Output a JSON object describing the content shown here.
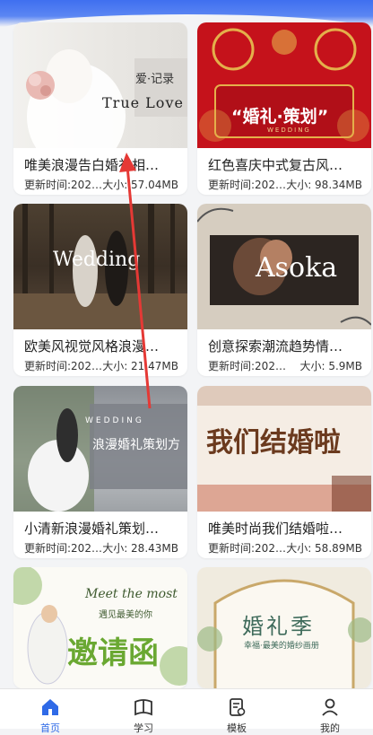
{
  "templates": [
    {
      "title": "唯美浪漫告白婚礼相…",
      "time": "更新时间:202…",
      "size": "大小: 57.04MB",
      "overlay": [
        "爱·记录",
        "True Love"
      ]
    },
    {
      "title": "红色喜庆中式复古风…",
      "time": "更新时间:202…",
      "size": "大小: 98.34MB",
      "overlay": [
        "“婚礼·策划”",
        "WEDDING"
      ]
    },
    {
      "title": "欧美风视觉风格浪漫…",
      "time": "更新时间:202…",
      "size": "大小: 21.47MB",
      "overlay": [
        "Wedding"
      ]
    },
    {
      "title": "创意探索潮流趋势情…",
      "time": "更新时间:202…",
      "size": "大小: 5.9MB",
      "overlay": [
        "Asoka"
      ]
    },
    {
      "title": "小清新浪漫婚礼策划…",
      "time": "更新时间:202…",
      "size": "大小: 28.43MB",
      "overlay": [
        "WEDDING",
        "浪漫婚礼策划方"
      ]
    },
    {
      "title": "唯美时尚我们结婚啦…",
      "time": "更新时间:202…",
      "size": "大小: 58.89MB",
      "overlay": [
        "我们结婚啦"
      ]
    },
    {
      "title": "",
      "time": "",
      "size": "",
      "overlay": [
        "Meet the most",
        "遇见最美的你",
        "邀请函"
      ]
    },
    {
      "title": "",
      "time": "",
      "size": "",
      "overlay": [
        "婚礼季",
        "幸福·最美的婚纱画册"
      ]
    }
  ],
  "tabs": [
    {
      "label": "首页",
      "icon": "home-icon",
      "active": true
    },
    {
      "label": "学习",
      "icon": "book-icon",
      "active": false
    },
    {
      "label": "模板",
      "icon": "template-icon",
      "active": false
    },
    {
      "label": "我的",
      "icon": "user-icon",
      "active": false
    }
  ],
  "colors": {
    "accent": "#2f6ae7",
    "annotation_arrow": "#e53935"
  }
}
